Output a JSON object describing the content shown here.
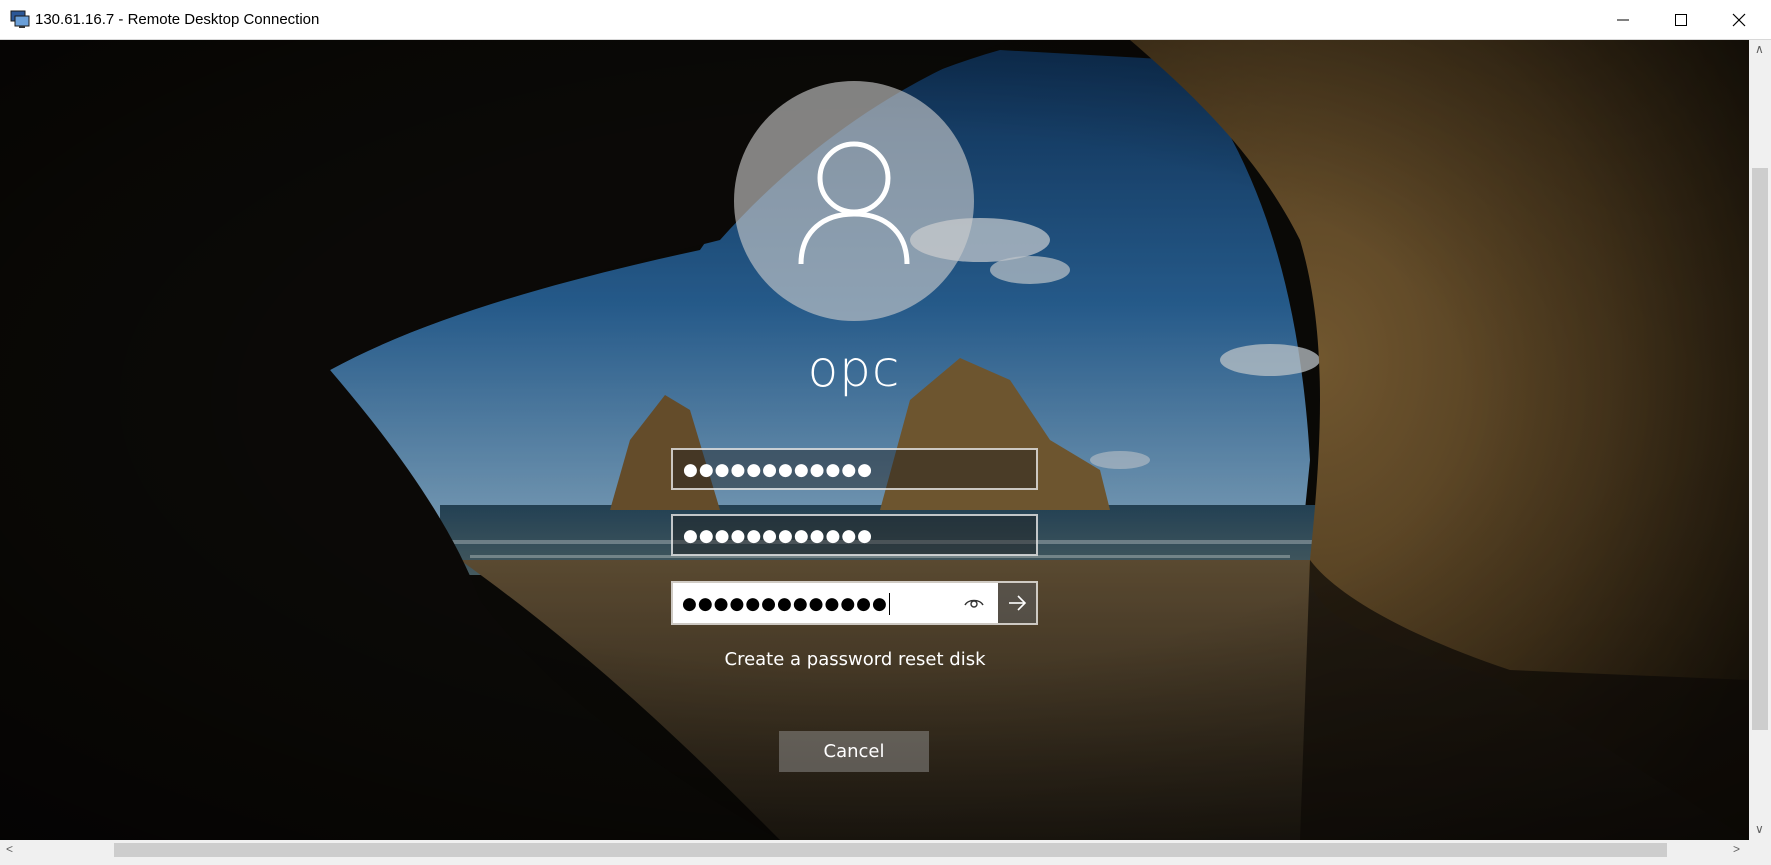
{
  "window": {
    "title": "130.61.16.7 - Remote Desktop Connection",
    "app_icon": "remote-desktop-icon",
    "controls": [
      "minimize-icon",
      "maximize-icon",
      "close-icon"
    ]
  },
  "login": {
    "avatar_icon": "user-icon",
    "username": "opc",
    "fields": [
      {
        "value": "●●●●●●●●●●●●"
      },
      {
        "value": "●●●●●●●●●●●●"
      }
    ],
    "password": {
      "value": "●●●●●●●●●●●●●",
      "reveal_icon": "eye-icon",
      "submit_icon": "arrow-right-icon"
    },
    "reset_link": "Create a password reset disk",
    "cancel_label": "Cancel"
  }
}
